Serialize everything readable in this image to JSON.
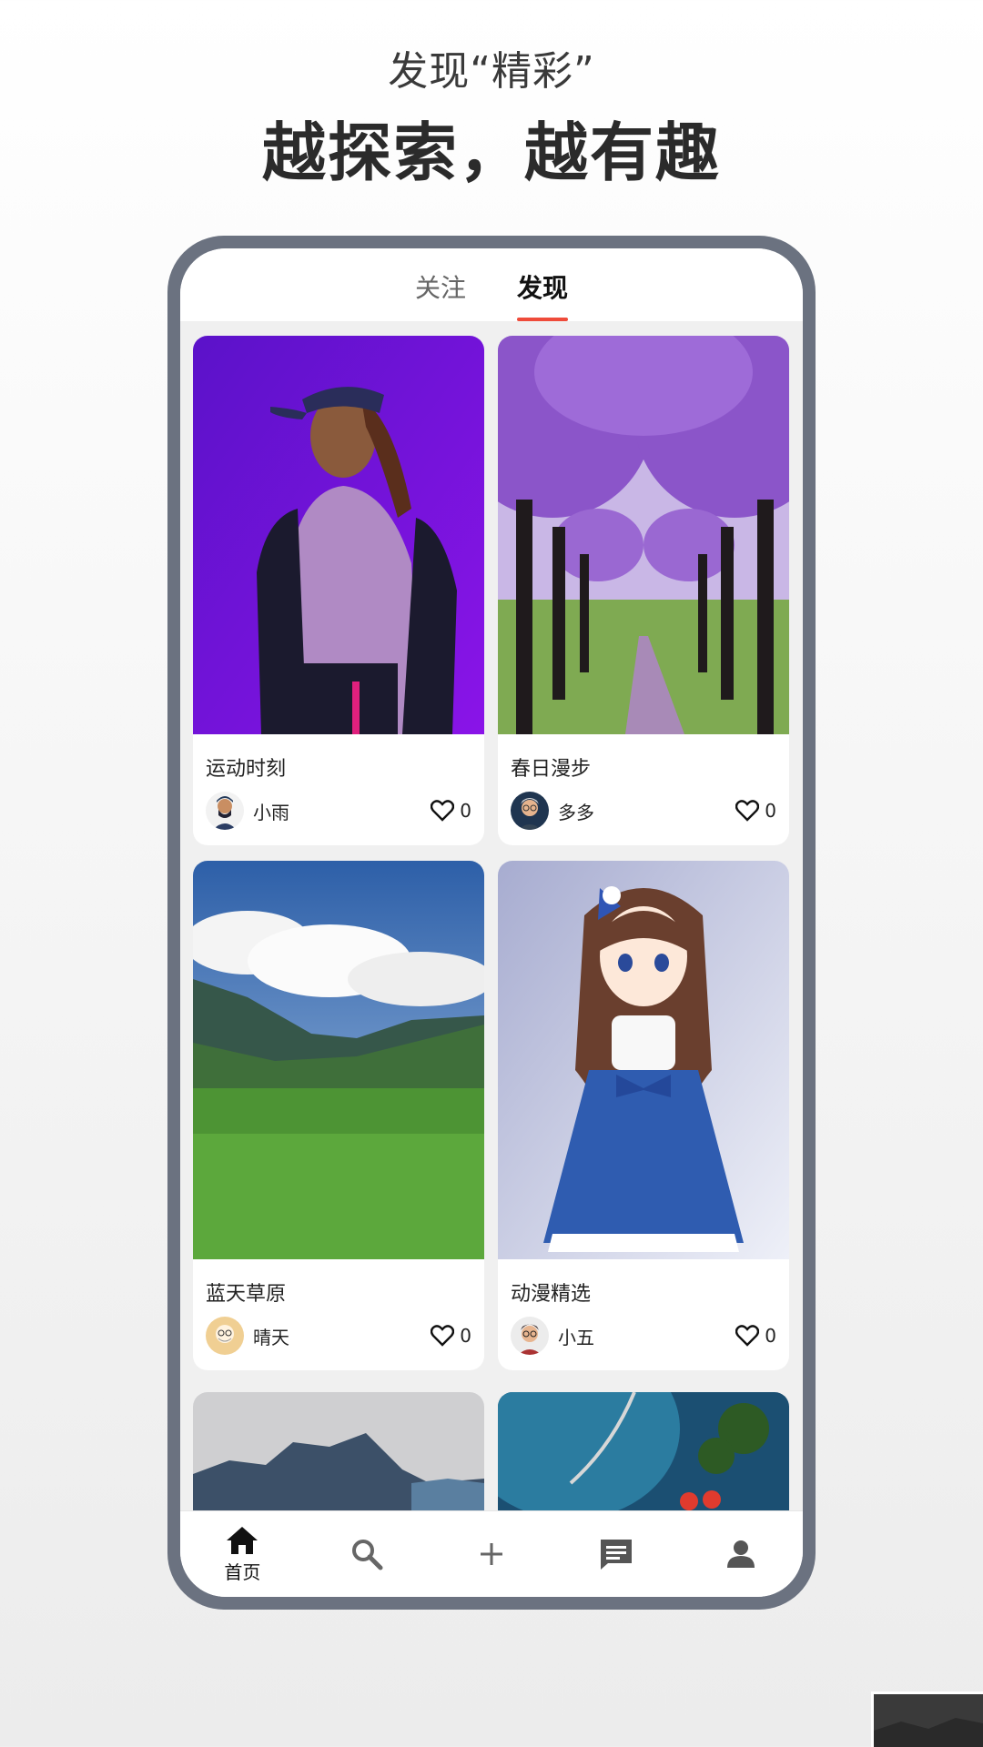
{
  "header": {
    "subtitle": "发现“精彩”",
    "title": "越探索，越有趣"
  },
  "tabs": [
    {
      "label": "关注",
      "active": false
    },
    {
      "label": "发现",
      "active": true
    }
  ],
  "cards": [
    {
      "title": "运动时刻",
      "author": "小雨",
      "likes": "0",
      "image": "girl in cap on purple background"
    },
    {
      "title": "春日漫步",
      "author": "多多",
      "likes": "0",
      "image": "purple tree-lined path"
    },
    {
      "title": "蓝天草原",
      "author": "晴天",
      "likes": "0",
      "image": "green meadow under blue sky"
    },
    {
      "title": "动漫精选",
      "author": "小五",
      "likes": "0",
      "image": "anime girl in blue dress"
    }
  ],
  "bottom_nav": {
    "home_label": "首页"
  },
  "colors": {
    "accent": "#ef4b3a",
    "phone_frame": "#6b7280",
    "feed_background": "#f0f0f0"
  }
}
